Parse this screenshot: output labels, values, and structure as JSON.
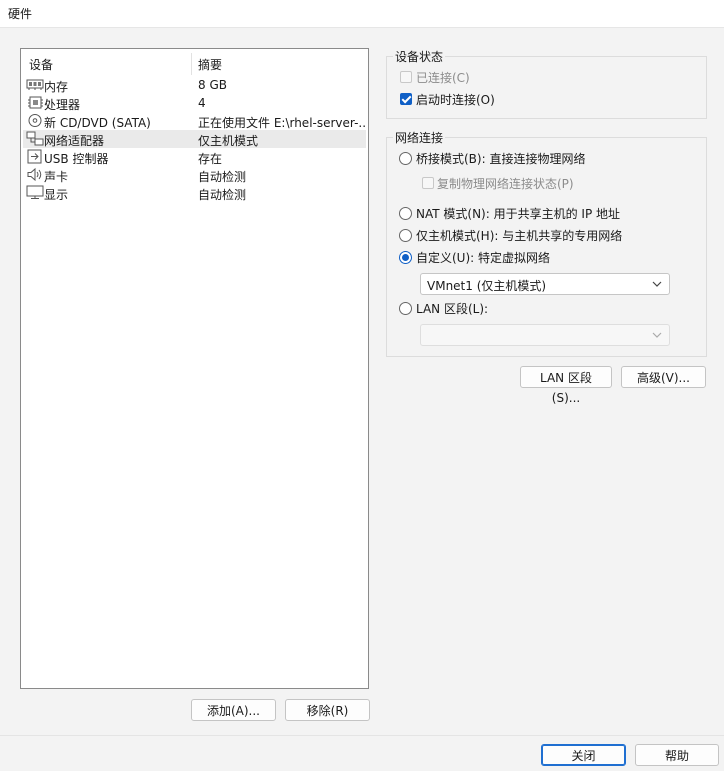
{
  "window": {
    "title": "硬件"
  },
  "device_list": {
    "col_device": "设备",
    "col_summary": "摘要",
    "rows": [
      {
        "name": "内存",
        "summary": "8 GB",
        "icon": "memory-icon"
      },
      {
        "name": "处理器",
        "summary": "4",
        "icon": "processor-icon"
      },
      {
        "name": "新 CD/DVD (SATA)",
        "summary": "正在使用文件 E:\\rhel-server-...",
        "icon": "cd-dvd-icon"
      },
      {
        "name": "网络适配器",
        "summary": "仅主机模式",
        "icon": "network-adapter-icon",
        "selected": true
      },
      {
        "name": "USB 控制器",
        "summary": "存在",
        "icon": "usb-icon"
      },
      {
        "name": "声卡",
        "summary": "自动检测",
        "icon": "speaker-icon"
      },
      {
        "name": "显示",
        "summary": "自动检测",
        "icon": "display-icon"
      }
    ]
  },
  "buttons": {
    "add": "添加(A)...",
    "remove": "移除(R)",
    "lan_segments": "LAN 区段(S)...",
    "advanced": "高级(V)...",
    "close": "关闭",
    "help": "帮助"
  },
  "device_status": {
    "title": "设备状态",
    "connected": {
      "label": "已连接(C)",
      "checked": false,
      "disabled": true
    },
    "connect_at_power_on": {
      "label": "启动时连接(O)",
      "checked": true
    }
  },
  "network_connection": {
    "title": "网络连接",
    "bridged": "桥接模式(B): 直接连接物理网络",
    "replicate": "复制物理网络连接状态(P)",
    "nat": "NAT 模式(N): 用于共享主机的 IP 地址",
    "host_only": "仅主机模式(H): 与主机共享的专用网络",
    "custom": "自定义(U): 特定虚拟网络",
    "custom_selected_value": "VMnet1 (仅主机模式)",
    "lan_segment": "LAN 区段(L):",
    "lan_segment_value": "",
    "selected": "custom"
  },
  "colors": {
    "accent": "#0f5fc6",
    "selection": "#eaeaea"
  }
}
